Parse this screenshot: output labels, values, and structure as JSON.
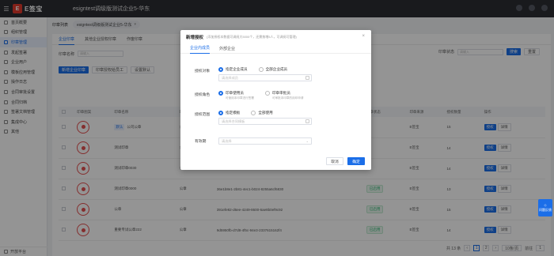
{
  "app": {
    "brand": "E签宝",
    "org_title": "esigntest调级版测试企业5-华东"
  },
  "sidebar": {
    "items": [
      {
        "label": "首页概要"
      },
      {
        "label": "组织管理"
      },
      {
        "label": "印章管理",
        "active": true
      },
      {
        "label": "发起签署"
      },
      {
        "label": "企业用户"
      },
      {
        "label": "模板应用管理"
      },
      {
        "label": "操作日志"
      },
      {
        "label": "合同审批设置"
      },
      {
        "label": "合同归档"
      },
      {
        "label": "签署文档管理"
      },
      {
        "label": "集成中心"
      },
      {
        "label": "其他"
      }
    ],
    "footer": "开放平台"
  },
  "breadcrumb": {
    "root": "印章列表",
    "chip": "esigntest调级版测试企业5-华东"
  },
  "page_tabs": [
    "企业印章",
    "其他企业授权印章",
    "作废印章"
  ],
  "filters": {
    "name_label": "印章名称",
    "name_placeholder": "请输入",
    "status_label": "印章状态",
    "search_btn": "搜索",
    "reset_btn": "重置"
  },
  "actions": [
    "新增企业印章",
    "印章授权给员工",
    "设置默认"
  ],
  "table": {
    "headers": [
      "",
      "印章图案",
      "印章名称",
      "印章类型",
      "印章ID",
      "印章状态",
      "印章来源",
      "授权数量",
      "操作"
    ],
    "rows": [
      {
        "name": "公司公章",
        "tag": "默认",
        "type": "公章",
        "id": "",
        "status": "",
        "source": "E签宝",
        "count": "15"
      },
      {
        "name": "测试印章",
        "tag": "",
        "type": "公章",
        "id": "",
        "status": "",
        "source": "E签宝",
        "count": "14"
      },
      {
        "name": "测试印章0030",
        "tag": "",
        "type": "公章",
        "id": "",
        "status": "",
        "source": "E签宝",
        "count": "14"
      },
      {
        "name": "测试印章0000",
        "tag": "",
        "type": "公章",
        "id": "36e1b8e1-2b81-4ec1-b024-8255a6cf6830",
        "status": "已启用",
        "source": "E签宝",
        "count": "13"
      },
      {
        "name": "公章",
        "tag": "",
        "type": "公章",
        "id": "391efe82-d6ee-4249-8600-6ae8b0ef9c92",
        "status": "已启用",
        "source": "E签宝",
        "count": "15"
      },
      {
        "name": "重要专试公章222",
        "tag": "",
        "type": "公章",
        "id": "9d5950fb-d7d8-4f5c-94e3-2337615162f4",
        "status": "已启用",
        "source": "E签宝",
        "count": "14"
      }
    ],
    "op_edit": "授权",
    "op_view": "详情"
  },
  "pager": {
    "total": "共 13 条",
    "prev": "‹",
    "page1": "1",
    "page2": "2",
    "next": "›",
    "size": "10条/页",
    "jump_label": "前往",
    "jump_value": "1"
  },
  "float_help": "问题反馈",
  "modal": {
    "title": "新增授权",
    "note": "(添加授权本数据可调阅大5000个，还需按增5人，可调阅可管理)",
    "close": "×",
    "tabs": [
      "企业内成员",
      "外部企业"
    ],
    "rows": {
      "scope": {
        "label": "授权对象",
        "opt1": "指定企业成员",
        "opt2": "全部企业成员",
        "placeholder": "请选择成员"
      },
      "role": {
        "label": "授权角色",
        "opt1": "印章使用员",
        "opt1_sub": "可使用本印章进行签署",
        "opt2": "印章审批员",
        "opt2_sub": "可审批本印章的用印申请"
      },
      "range": {
        "label": "授权范围",
        "opt1": "指定模板",
        "opt2": "全部使用",
        "placeholder": "请选择合同模板"
      },
      "expire": {
        "label": "有效期",
        "placeholder": "请选择"
      }
    },
    "cancel": "取消",
    "ok": "确定"
  }
}
